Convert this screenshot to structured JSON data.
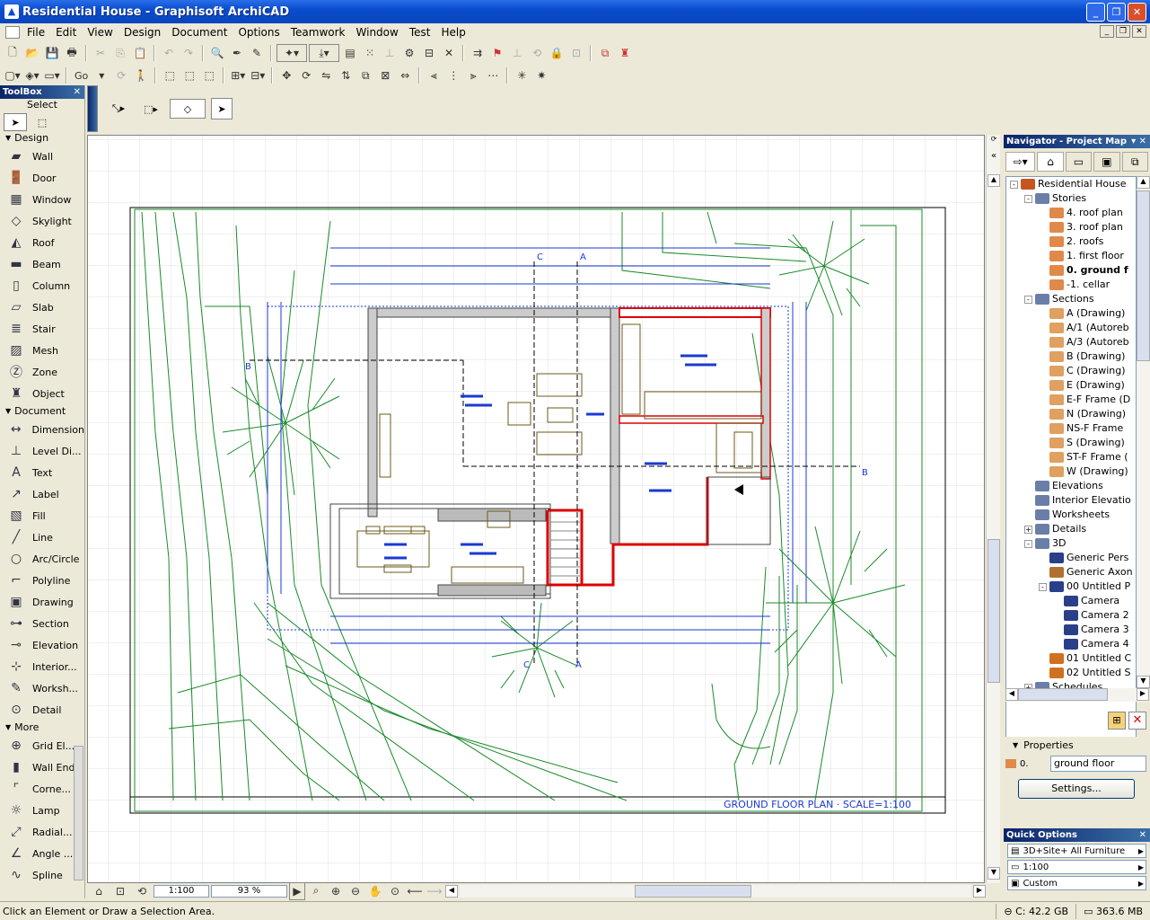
{
  "window": {
    "title": "Residential House - Graphisoft ArchiCAD",
    "icon": "archicad-icon"
  },
  "menu": [
    "File",
    "Edit",
    "View",
    "Design",
    "Document",
    "Options",
    "Teamwork",
    "Window",
    "Test",
    "Help"
  ],
  "toolbox": {
    "title": "ToolBox",
    "select_label": "Select",
    "groups": [
      {
        "name": "Design",
        "tools": [
          {
            "label": "Wall",
            "icon": "wall-icon"
          },
          {
            "label": "Door",
            "icon": "door-icon"
          },
          {
            "label": "Window",
            "icon": "window-icon"
          },
          {
            "label": "Skylight",
            "icon": "skylight-icon"
          },
          {
            "label": "Roof",
            "icon": "roof-icon"
          },
          {
            "label": "Beam",
            "icon": "beam-icon"
          },
          {
            "label": "Column",
            "icon": "column-icon"
          },
          {
            "label": "Slab",
            "icon": "slab-icon"
          },
          {
            "label": "Stair",
            "icon": "stair-icon"
          },
          {
            "label": "Mesh",
            "icon": "mesh-icon"
          },
          {
            "label": "Zone",
            "icon": "zone-icon"
          },
          {
            "label": "Object",
            "icon": "object-icon"
          }
        ]
      },
      {
        "name": "Document",
        "tools": [
          {
            "label": "Dimension",
            "icon": "dimension-icon"
          },
          {
            "label": "Level Di...",
            "icon": "level-dimension-icon"
          },
          {
            "label": "Text",
            "icon": "text-icon"
          },
          {
            "label": "Label",
            "icon": "label-icon"
          },
          {
            "label": "Fill",
            "icon": "fill-icon"
          },
          {
            "label": "Line",
            "icon": "line-icon"
          },
          {
            "label": "Arc/Circle",
            "icon": "arc-circle-icon"
          },
          {
            "label": "Polyline",
            "icon": "polyline-icon"
          },
          {
            "label": "Drawing",
            "icon": "drawing-icon"
          },
          {
            "label": "Section",
            "icon": "section-icon"
          },
          {
            "label": "Elevation",
            "icon": "elevation-icon"
          },
          {
            "label": "Interior...",
            "icon": "interior-elevation-icon"
          },
          {
            "label": "Worksh...",
            "icon": "worksheet-icon"
          },
          {
            "label": "Detail",
            "icon": "detail-icon"
          }
        ]
      },
      {
        "name": "More",
        "tools": [
          {
            "label": "Grid El...",
            "icon": "grid-element-icon"
          },
          {
            "label": "Wall End",
            "icon": "wall-end-icon"
          },
          {
            "label": "Corne...",
            "icon": "corner-window-icon"
          },
          {
            "label": "Lamp",
            "icon": "lamp-icon"
          },
          {
            "label": "Radial...",
            "icon": "radial-dimension-icon"
          },
          {
            "label": "Angle ...",
            "icon": "angle-dimension-icon"
          },
          {
            "label": "Spline",
            "icon": "spline-icon"
          }
        ]
      }
    ]
  },
  "toolbar2": {
    "go_label": "Go"
  },
  "drawing": {
    "caption": "GROUND FLOOR PLAN · SCALE=1:100",
    "markers": [
      "C",
      "A",
      "B",
      "B",
      "C",
      "A"
    ]
  },
  "zoom": {
    "scale": "1:100",
    "percent": "93 %"
  },
  "navigator": {
    "title": "Navigator - Project Map",
    "tree": [
      {
        "label": "Residential House",
        "level": 0,
        "exp": "-",
        "icon": "house"
      },
      {
        "label": "Stories",
        "level": 1,
        "exp": "-",
        "icon": "folder"
      },
      {
        "label": "4. roof plan",
        "level": 2,
        "icon": "story"
      },
      {
        "label": "3. roof plan",
        "level": 2,
        "icon": "story"
      },
      {
        "label": "2. roofs",
        "level": 2,
        "icon": "story"
      },
      {
        "label": "1. first floor",
        "level": 2,
        "icon": "story"
      },
      {
        "label": "0. ground f",
        "level": 2,
        "icon": "story",
        "bold": true
      },
      {
        "label": "-1. cellar",
        "level": 2,
        "icon": "story"
      },
      {
        "label": "Sections",
        "level": 1,
        "exp": "-",
        "icon": "folder"
      },
      {
        "label": "A (Drawing)",
        "level": 2,
        "icon": "section"
      },
      {
        "label": "A/1 (Autoreb",
        "level": 2,
        "icon": "section"
      },
      {
        "label": "A/3 (Autoreb",
        "level": 2,
        "icon": "section"
      },
      {
        "label": "B (Drawing)",
        "level": 2,
        "icon": "section"
      },
      {
        "label": "C (Drawing)",
        "level": 2,
        "icon": "section"
      },
      {
        "label": "E (Drawing)",
        "level": 2,
        "icon": "section"
      },
      {
        "label": "E-F Frame (D",
        "level": 2,
        "icon": "section"
      },
      {
        "label": "N (Drawing)",
        "level": 2,
        "icon": "section"
      },
      {
        "label": "NS-F Frame",
        "level": 2,
        "icon": "section"
      },
      {
        "label": "S (Drawing)",
        "level": 2,
        "icon": "section"
      },
      {
        "label": "ST-F Frame (",
        "level": 2,
        "icon": "section"
      },
      {
        "label": "W (Drawing)",
        "level": 2,
        "icon": "section"
      },
      {
        "label": "Elevations",
        "level": 1,
        "icon": "folder"
      },
      {
        "label": "Interior Elevatio",
        "level": 1,
        "icon": "folder"
      },
      {
        "label": "Worksheets",
        "level": 1,
        "icon": "folder"
      },
      {
        "label": "Details",
        "level": 1,
        "exp": "+",
        "icon": "folder"
      },
      {
        "label": "3D",
        "level": 1,
        "exp": "-",
        "icon": "folder"
      },
      {
        "label": "Generic Pers",
        "level": 2,
        "icon": "camera"
      },
      {
        "label": "Generic Axon",
        "level": 2,
        "icon": "axon"
      },
      {
        "label": "00 Untitled P",
        "level": 2,
        "exp": "-",
        "icon": "camera"
      },
      {
        "label": "Camera",
        "level": 3,
        "icon": "camera"
      },
      {
        "label": "Camera 2",
        "level": 3,
        "icon": "camera"
      },
      {
        "label": "Camera 3",
        "level": 3,
        "icon": "camera"
      },
      {
        "label": "Camera 4",
        "level": 3,
        "icon": "camera"
      },
      {
        "label": "01 Untitled C",
        "level": 2,
        "icon": "render"
      },
      {
        "label": "02 Untitled S",
        "level": 2,
        "icon": "render"
      },
      {
        "label": "Schedules",
        "level": 1,
        "exp": "+",
        "icon": "folder"
      }
    ]
  },
  "properties": {
    "title": "Properties",
    "index": "0.",
    "name_value": "ground floor",
    "settings_label": "Settings..."
  },
  "quick_options": {
    "title": "Quick Options",
    "items": [
      {
        "value": "3D+Site+ All Furniture",
        "icon": "layer-combination-icon"
      },
      {
        "value": "1:100",
        "icon": "scale-icon"
      },
      {
        "value": "Custom",
        "icon": "display-options-icon"
      }
    ]
  },
  "status": {
    "message": "Click an Element or Draw a Selection Area.",
    "disk": "C: 42.2 GB",
    "memory": "363.6 MB"
  }
}
